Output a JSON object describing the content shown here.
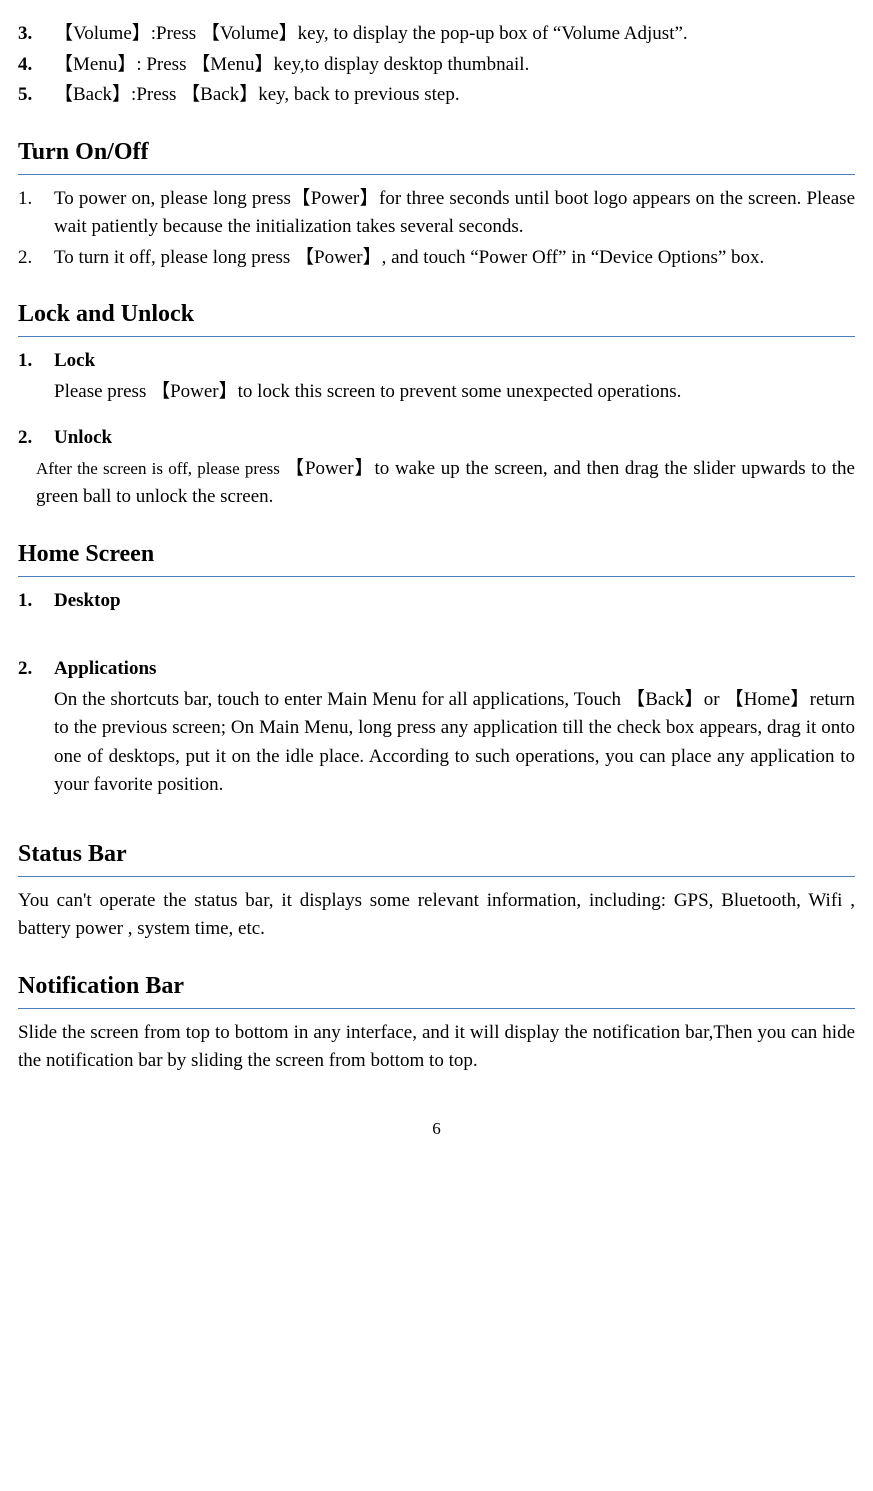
{
  "top_items": [
    {
      "num": "3.",
      "text": "【Volume】:Press 【Volume】key, to display the pop-up box of “Volume Adjust”."
    },
    {
      "num": "4.",
      "text": "【Menu】: Press  【Menu】key,to display desktop thumbnail."
    },
    {
      "num": "5.",
      "text": "【Back】:Press  【Back】key, back to previous step."
    }
  ],
  "sections": {
    "turn_on_off": {
      "heading": "Turn On/Off",
      "items": [
        {
          "num": "1.",
          "text": "To power on, please long press【Power】for three seconds until boot logo appears on the screen. Please wait patiently because the initialization takes several seconds."
        },
        {
          "num": "2.",
          "text": "To turn it off, please long press  【Power】, and touch “Power Off” in “Device Options” box."
        }
      ]
    },
    "lock_unlock": {
      "heading": "Lock and Unlock",
      "item1_num": "1.",
      "item1_title": "Lock",
      "item1_body": "Please press  【Power】to lock this screen to prevent some unexpected operations.",
      "item2_num": "2.",
      "item2_title": "Unlock",
      "item2_lead": "After the screen is off, please press ",
      "item2_rest": " 【Power】to wake up the screen, and then drag the slider upwards to the green ball to unlock the screen."
    },
    "home_screen": {
      "heading": "Home Screen",
      "item1_num": "1.",
      "item1_title": "Desktop",
      "item2_num": "2.",
      "item2_title": "Applications",
      "item2_body": "On the shortcuts bar, touch  to enter Main Menu for all applications, Touch 【Back】or 【Home】return to the previous screen; On Main Menu, long press any application till the check box appears, drag it onto one of desktops, put it on the idle place. According to such operations, you can place any application to your favorite position."
    },
    "status_bar": {
      "heading": "Status Bar",
      "body": "You can't operate the status bar, it displays some relevant information, including: GPS, Bluetooth, Wifi , battery power , system time, etc."
    },
    "notification_bar": {
      "heading": "Notification Bar",
      "body": "Slide the screen from top to bottom in any interface, and it will display the notification bar,Then you can hide the notification bar by sliding the screen from bottom to top."
    }
  },
  "page_number": "6"
}
